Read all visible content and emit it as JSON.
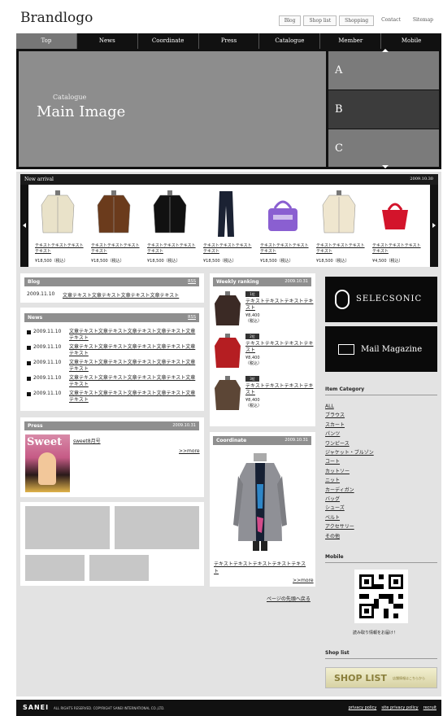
{
  "header": {
    "logo": "Brandlogo",
    "util_links": [
      "Blog",
      "Shop list",
      "Shopping",
      "Contact",
      "Sitemap"
    ]
  },
  "nav": [
    "Top",
    "News",
    "Coordinate",
    "Press",
    "Catalogue",
    "Member",
    "Mobile"
  ],
  "hero": {
    "subtitle": "Catalogue",
    "title": "Main Image",
    "tabs": [
      "A",
      "B",
      "C"
    ]
  },
  "new_arrival": {
    "title": "New arrival",
    "date": "2009.10.30",
    "items": [
      {
        "name": "テキストテキストテキストテキスト",
        "price": "¥18,500（税込）",
        "icon": "coat-icon",
        "color": "#e9e2c9"
      },
      {
        "name": "テキストテキストテキストテキスト",
        "price": "¥18,500（税込）",
        "icon": "jacket-icon",
        "color": "#6b3b1c"
      },
      {
        "name": "テキストテキストテキストテキスト",
        "price": "¥18,500（税込）",
        "icon": "cardigan-icon",
        "color": "#111111"
      },
      {
        "name": "テキストテキストテキストテキスト",
        "price": "¥18,500（税込）",
        "icon": "jeans-icon",
        "color": "#1b2233"
      },
      {
        "name": "テキストテキストテキストテキスト",
        "price": "¥18,500（税込）",
        "icon": "bag-icon",
        "color": "#8a5fd1"
      },
      {
        "name": "テキストテキストテキストテキスト",
        "price": "¥18,500（税込）",
        "icon": "coat-icon",
        "color": "#efe6cf"
      },
      {
        "name": "テキストテキストテキストテキスト",
        "price": "¥4,500（税込）",
        "icon": "handbag-icon",
        "color": "#d3142b"
      }
    ]
  },
  "blog": {
    "title": "Blog",
    "rss": "RSS",
    "date": "2009.11.10",
    "text": "文章テキスト文章テキスト文章テキスト文章テキスト"
  },
  "news": {
    "title": "News",
    "rss": "RSS",
    "items": [
      {
        "date": "2009.11.10",
        "text": "文章テキスト文章テキスト文章テキスト文章テキスト文章テキスト"
      },
      {
        "date": "2009.11.10",
        "text": "文章テキスト文章テキスト文章テキスト文章テキスト文章テキスト"
      },
      {
        "date": "2009.11.10",
        "text": "文章テキスト文章テキスト文章テキスト文章テキスト文章テキスト"
      },
      {
        "date": "2009.11.10",
        "text": "文章テキスト文章テキスト文章テキスト文章テキスト文章テキスト"
      },
      {
        "date": "2009.11.10",
        "text": "文章テキスト文章テキスト文章テキスト文章テキスト文章テキスト"
      }
    ]
  },
  "press": {
    "title": "Press",
    "date": "2009.10.31",
    "magazine": "Sweet",
    "issue": "sweet8月号",
    "more": ">>more"
  },
  "ranking": {
    "title": "Weekly ranking",
    "date": "2009.10.31",
    "items": [
      {
        "rank": "1位",
        "name": "テキストテキストテキストテキスト",
        "price": "¥8,400（税込）",
        "color": "#3b2a25"
      },
      {
        "rank": "2位",
        "name": "テキストテキストテキストテキスト",
        "price": "¥8,400（税込）",
        "color": "#b51e22"
      },
      {
        "rank": "3位",
        "name": "テキストテキストテキストテキスト",
        "price": "¥8,400（税込）",
        "color": "#5c4636"
      }
    ]
  },
  "coordinate": {
    "title": "Coordinate",
    "date": "2009.10.31",
    "text": "テキストテキストテキストテキストテキスト",
    "more": ">>more"
  },
  "page_top": "ページの先頭へ戻る",
  "sidebar": {
    "selecsonic": "SELECSONIC",
    "mail": "Mail Magazine",
    "category_title": "Item Category",
    "categories": [
      "ALL",
      "ブラウス",
      "スカート",
      "パンツ",
      "ワンピース",
      "ジャケット・ブルゾン",
      "コート",
      "カットソー",
      "ニット",
      "カーディガン",
      "バッグ",
      "シューズ",
      "ベルト",
      "アクセサリー",
      "その他"
    ],
    "mobile_title": "Mobile",
    "mobile_note": "読み取り情報をお届け！",
    "shoplist_title": "Shop list",
    "shoplist_banner": "SHOP LIST",
    "shoplist_sub": "店舗情報はこちらから"
  },
  "footer": {
    "logo": "SANEI",
    "copyright": "ALL RIGHTS RESERVED. COPYRIGHT SANEI INTERNATIONAL CO.,LTD.",
    "links": [
      "privacy policy",
      "site privacy policy",
      "recruit"
    ]
  }
}
